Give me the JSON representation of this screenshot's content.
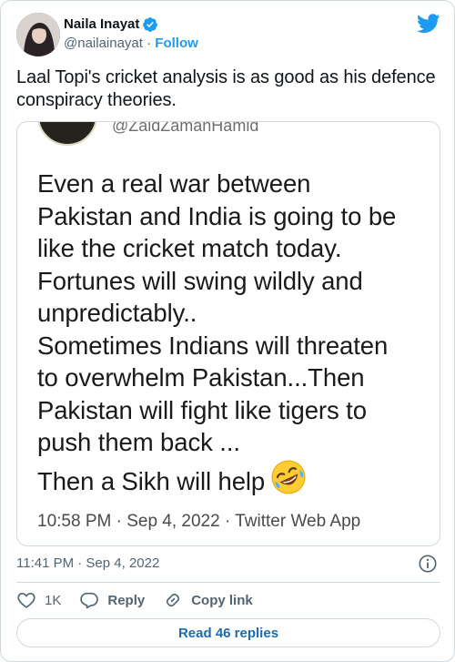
{
  "author": {
    "display_name": "Naila Inayat",
    "handle": "@nailainayat",
    "separator": "·",
    "follow_label": "Follow"
  },
  "tweet": {
    "text": "Laal Topi's cricket analysis is as good as his defence conspiracy theories.",
    "timestamp": "11:41 PM · Sep 4, 2022"
  },
  "embedded_image": {
    "handle": "@ZaidZamanHamid",
    "lines": [
      "Even a real war between",
      "Pakistan and India is going to be",
      "like the cricket match today.",
      "Fortunes will swing wildly and",
      "unpredictably..",
      "Sometimes Indians will threaten",
      "to overwhelm Pakistan...Then",
      "Pakistan will fight like tigers to",
      "push them back ...",
      "Then a Sikh will help"
    ],
    "meta": "10:58 PM · Sep 4, 2022 · Twitter Web App"
  },
  "actions": {
    "like_count": "1K",
    "reply_label": "Reply",
    "copy_label": "Copy link"
  },
  "read_replies_label": "Read 46 replies",
  "colors": {
    "accent": "#1d9bf0",
    "secondary_text": "#536471",
    "border": "#cfd9de"
  }
}
